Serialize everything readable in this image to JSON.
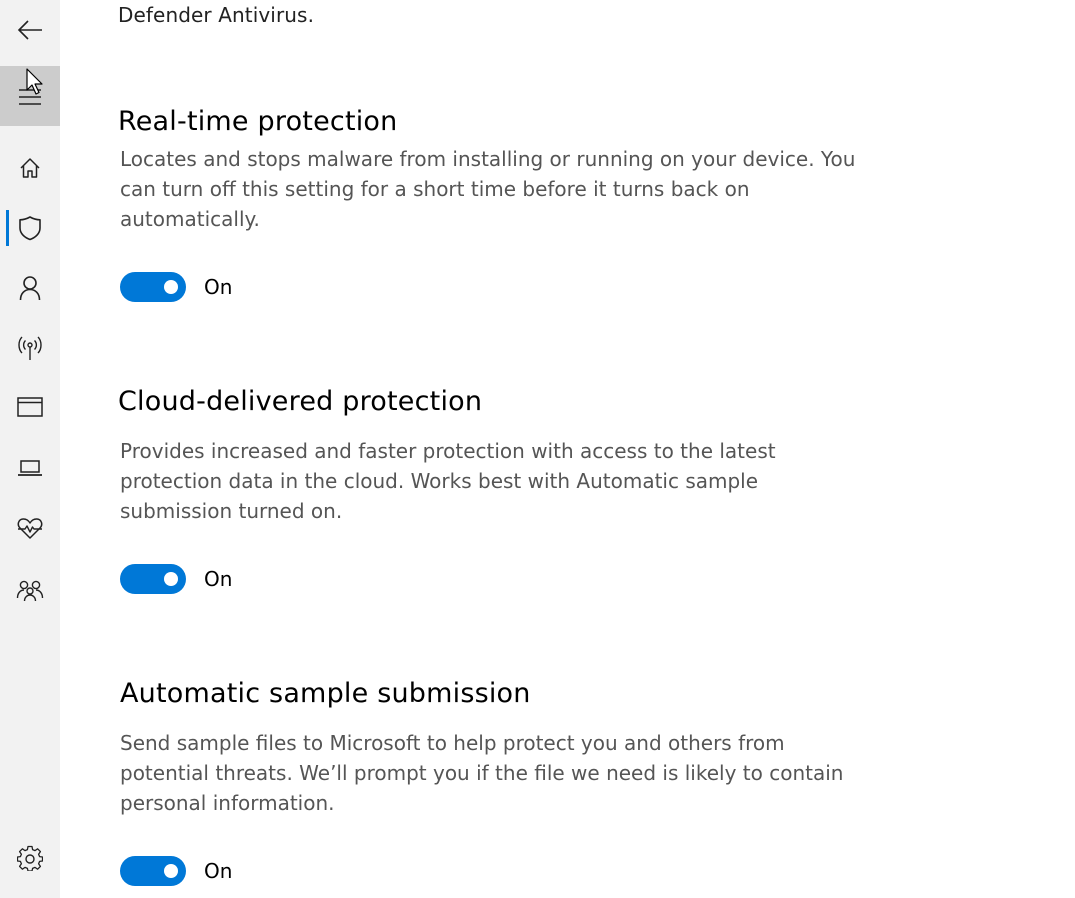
{
  "intro_text": "Defender Antivirus.",
  "sidebar": {
    "items": [
      {
        "icon": "back-arrow-icon"
      },
      {
        "icon": "hamburger-menu-icon"
      },
      {
        "icon": "home-icon"
      },
      {
        "icon": "shield-icon",
        "selected": true
      },
      {
        "icon": "person-icon"
      },
      {
        "icon": "wireless-antenna-icon"
      },
      {
        "icon": "app-browser-window-icon"
      },
      {
        "icon": "laptop-icon"
      },
      {
        "icon": "heart-pulse-icon"
      },
      {
        "icon": "family-icon"
      },
      {
        "icon": "gear-icon"
      }
    ],
    "accent_color": "#0078d7"
  },
  "sections": [
    {
      "title": "Real-time protection",
      "description": "Locates and stops malware from installing or running on your device. You can turn off this setting for a short time before it turns back on automatically.",
      "toggle_state": "On"
    },
    {
      "title": "Cloud-delivered protection",
      "description": "Provides increased and faster protection with access to the latest protection data in the cloud. Works best with Automatic sample submission turned on.",
      "toggle_state": "On"
    },
    {
      "title": "Automatic sample submission",
      "description": "Send sample files to Microsoft to help protect you and others from potential threats. We’ll prompt you if the file we need is likely to contain personal information.",
      "toggle_state": "On"
    }
  ],
  "colors": {
    "toggle_on": "#0078d7",
    "sidebar_bg": "#f2f2f2",
    "hover_bg": "#cccccc"
  }
}
